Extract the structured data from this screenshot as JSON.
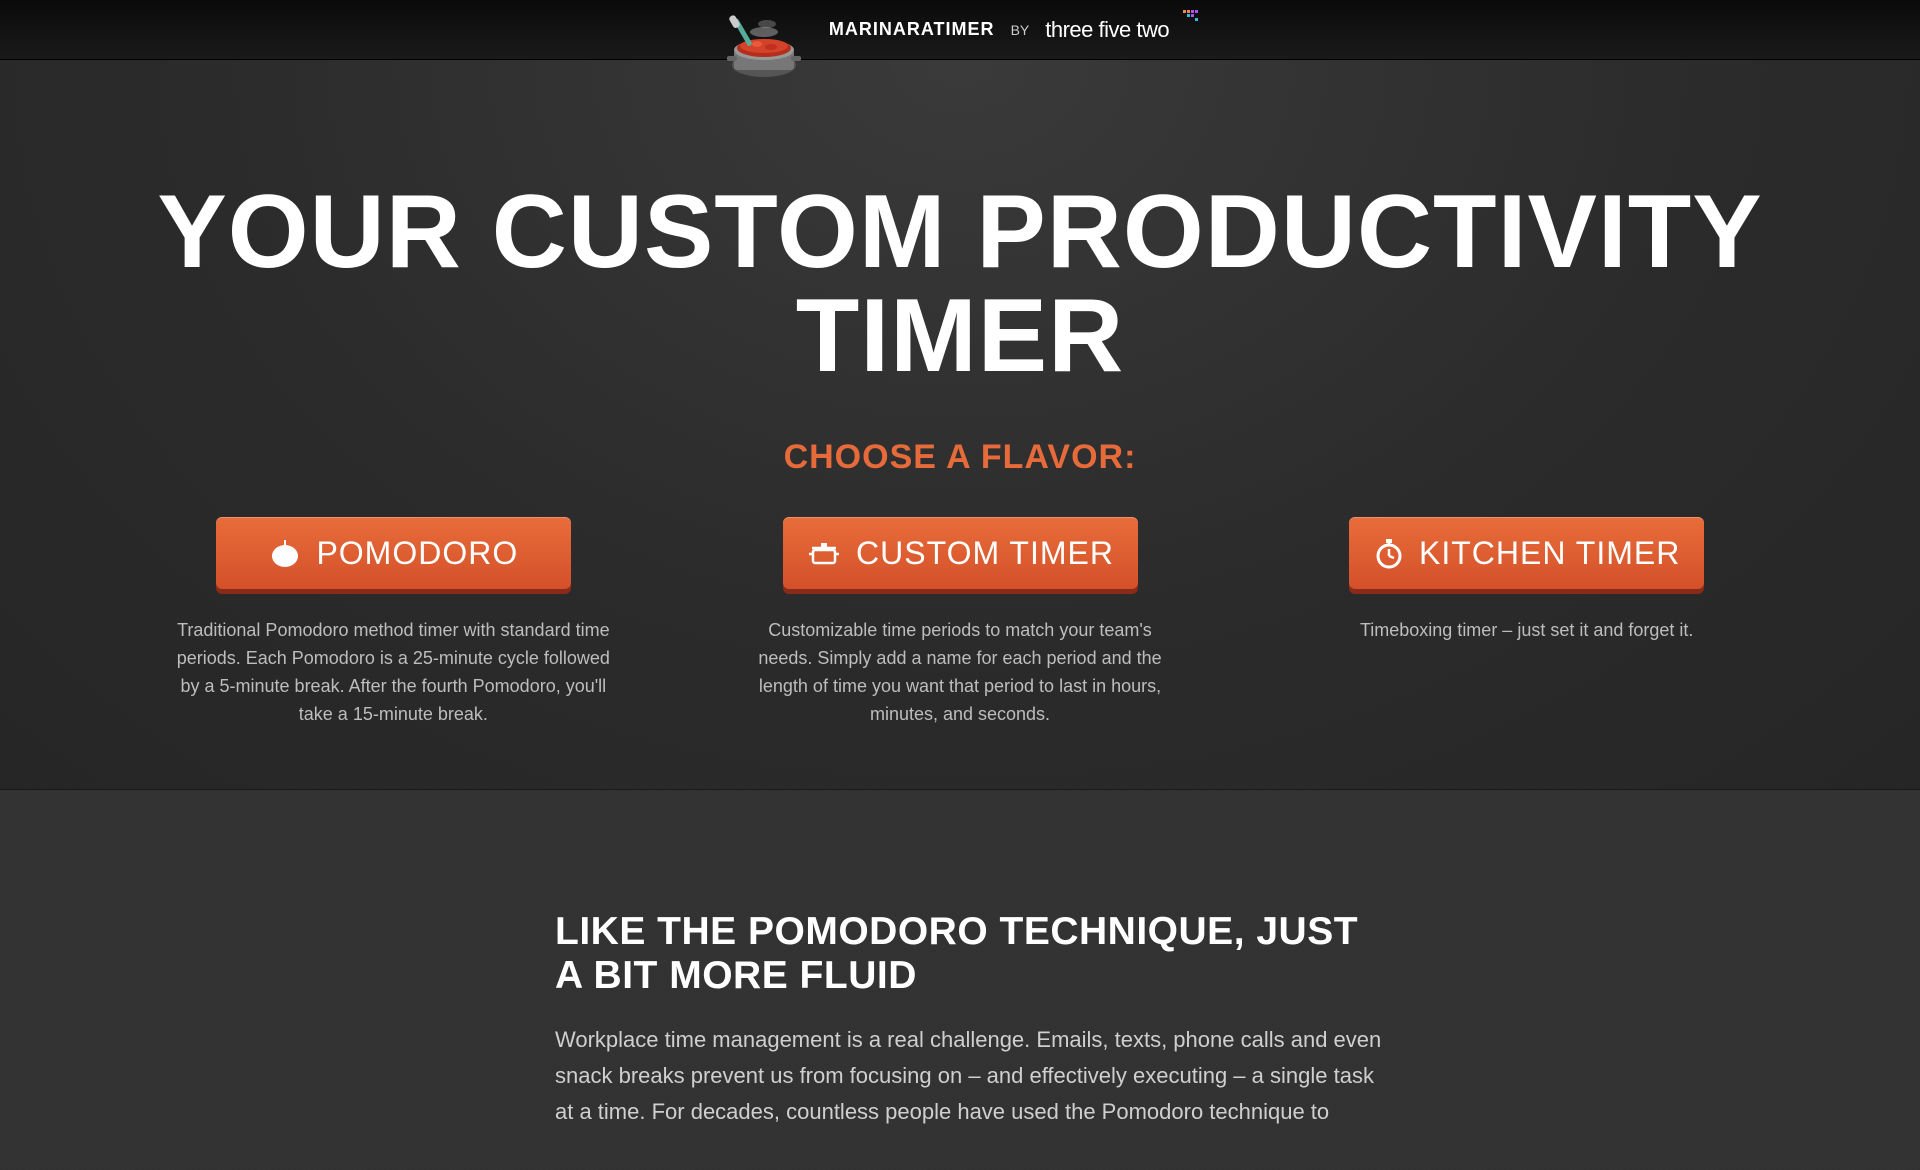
{
  "header": {
    "brand_main": "MARINARATIMER",
    "brand_by": "BY",
    "brand_company": "three five two"
  },
  "hero": {
    "title": "YOUR CUSTOM PRODUCTIVITY TIMER",
    "subtitle": "CHOOSE A FLAVOR:"
  },
  "flavors": [
    {
      "icon": "tomato-icon",
      "label": "POMODORO",
      "desc": "Traditional Pomodoro method timer with standard time periods. Each Pomodoro is a 25-minute cycle followed by a 5-minute break. After the fourth Pomodoro, you'll take a 15-minute break."
    },
    {
      "icon": "pot-icon",
      "label": "CUSTOM TIMER",
      "desc": "Customizable time periods to match your team's needs. Simply add a name for each period and the length of time you want that period to last in hours, minutes, and seconds."
    },
    {
      "icon": "stopwatch-icon",
      "label": "KITCHEN TIMER",
      "desc": "Timeboxing timer – just set it and forget it."
    }
  ],
  "article": {
    "title": "LIKE THE POMODORO TECHNIQUE, JUST A BIT MORE FLUID",
    "body": "Workplace time management is a real challenge. Emails, texts, phone calls and even snack breaks prevent us from focusing on – and effectively executing – a single task at a time. For decades, countless people have used the Pomodoro technique to"
  }
}
